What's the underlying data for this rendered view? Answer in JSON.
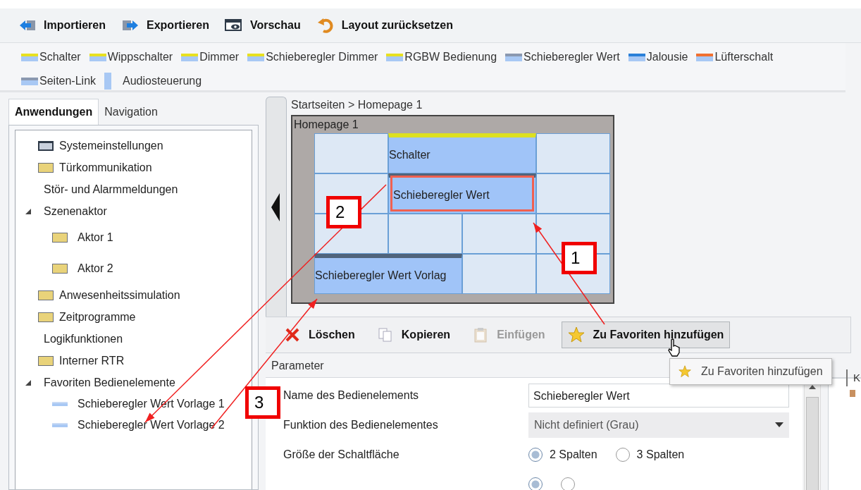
{
  "toolbar": [
    {
      "label": "Importieren"
    },
    {
      "label": "Exportieren"
    },
    {
      "label": "Vorschau"
    },
    {
      "label": "Layout zurücksetzen"
    }
  ],
  "palette": [
    {
      "label": "Schalter",
      "kind": "bar",
      "color": "#e8e020"
    },
    {
      "label": "Wippschalter",
      "kind": "bar",
      "color": "#e8e020"
    },
    {
      "label": "Dimmer",
      "kind": "bar",
      "color": "#e8e020"
    },
    {
      "label": "Schieberegler Dimmer",
      "kind": "bar",
      "color": "#e8e020"
    },
    {
      "label": "RGBW Bedienung",
      "kind": "bar",
      "color": "#e8e020"
    },
    {
      "label": "Schieberegler Wert",
      "kind": "bar",
      "color": "#8a98b0"
    },
    {
      "label": "Jalousie",
      "kind": "bar",
      "color": "#2a80d8"
    },
    {
      "label": "Lüfterschalt",
      "kind": "bar",
      "color": "#f07030"
    },
    {
      "label": "Seiten-Link",
      "kind": "bar",
      "color": "#8a98b0"
    },
    {
      "label": "Audiosteuerung",
      "kind": "tall",
      "color": "#a8c8f4"
    }
  ],
  "sidebar": {
    "tabs": [
      {
        "label": "Anwendungen",
        "selected": true
      },
      {
        "label": "Navigation",
        "selected": false
      }
    ],
    "tree": [
      {
        "label": "Systemeinstellungen",
        "kind": "monitor"
      },
      {
        "label": "Türkommunikation",
        "kind": "folder"
      },
      {
        "label": "Stör- und Alarmmeldungen",
        "kind": "plain"
      },
      {
        "label": "Szenenaktor",
        "kind": "plain",
        "expanded": true,
        "children": [
          {
            "label": "Aktor 1",
            "kind": "folder"
          },
          {
            "label": "Aktor 2",
            "kind": "folder"
          }
        ]
      },
      {
        "label": "Anwesenheitssimulation",
        "kind": "folder"
      },
      {
        "label": "Zeitprogramme",
        "kind": "folder"
      },
      {
        "label": "Logikfunktionen",
        "kind": "plain"
      },
      {
        "label": "Interner RTR",
        "kind": "folder"
      },
      {
        "label": "Favoriten Bedienelemente",
        "kind": "plain",
        "expanded": true,
        "children": [
          {
            "label": "Schieberegler Wert Vorlage 1",
            "kind": "slider"
          },
          {
            "label": "Schieberegler Wert Vorlage 2",
            "kind": "slider"
          }
        ]
      }
    ]
  },
  "breadcrumb": "Startseiten > Homepage 1",
  "canvas": {
    "title": "Homepage 1",
    "tiles": [
      {
        "kind": "empty"
      },
      {
        "kind": "wide",
        "label": "Schalter",
        "color": "#dde020",
        "selected": false
      },
      {
        "kind": "empty"
      },
      {
        "kind": "empty"
      },
      {
        "kind": "wide",
        "label": "Schieberegler Wert",
        "color": "#50647c",
        "selected": true
      },
      {
        "kind": "empty"
      },
      {
        "kind": "empty"
      },
      {
        "kind": "empty"
      },
      {
        "kind": "empty"
      },
      {
        "kind": "empty"
      },
      {
        "kind": "wide",
        "label": "Schieberegler Wert Vorlag",
        "color": "#50647c",
        "selected": false
      },
      {
        "kind": "empty"
      },
      {
        "kind": "empty"
      }
    ]
  },
  "actions": [
    {
      "label": "Löschen",
      "kind": "delete",
      "disabled": false,
      "hovered": false
    },
    {
      "label": "Kopieren",
      "kind": "copy",
      "disabled": false,
      "hovered": false
    },
    {
      "label": "Einfügen",
      "kind": "paste",
      "disabled": true,
      "hovered": false
    },
    {
      "label": "Zu Favoriten hinzufügen",
      "kind": "favorite",
      "disabled": false,
      "hovered": true
    }
  ],
  "tooltip": "Zu Favoriten hinzufügen",
  "parameters": {
    "title": "Parameter",
    "rows": [
      {
        "kind": "text",
        "label": "Name des Bedienelements",
        "value": "Schieberegler Wert"
      },
      {
        "kind": "select",
        "label": "Funktion des Bedienelementes",
        "value": "Nicht definiert (Grau)"
      },
      {
        "kind": "radio",
        "label": "Größe der Schaltfläche",
        "options": [
          {
            "label": "2 Spalten",
            "selected": true
          },
          {
            "label": "3 Spalten",
            "selected": false
          }
        ]
      },
      {
        "kind": "radio",
        "options": [
          {
            "selected": true
          },
          {
            "selected": false
          }
        ]
      }
    ]
  },
  "side_tab": "K",
  "callouts": [
    "1",
    "2",
    "3"
  ]
}
